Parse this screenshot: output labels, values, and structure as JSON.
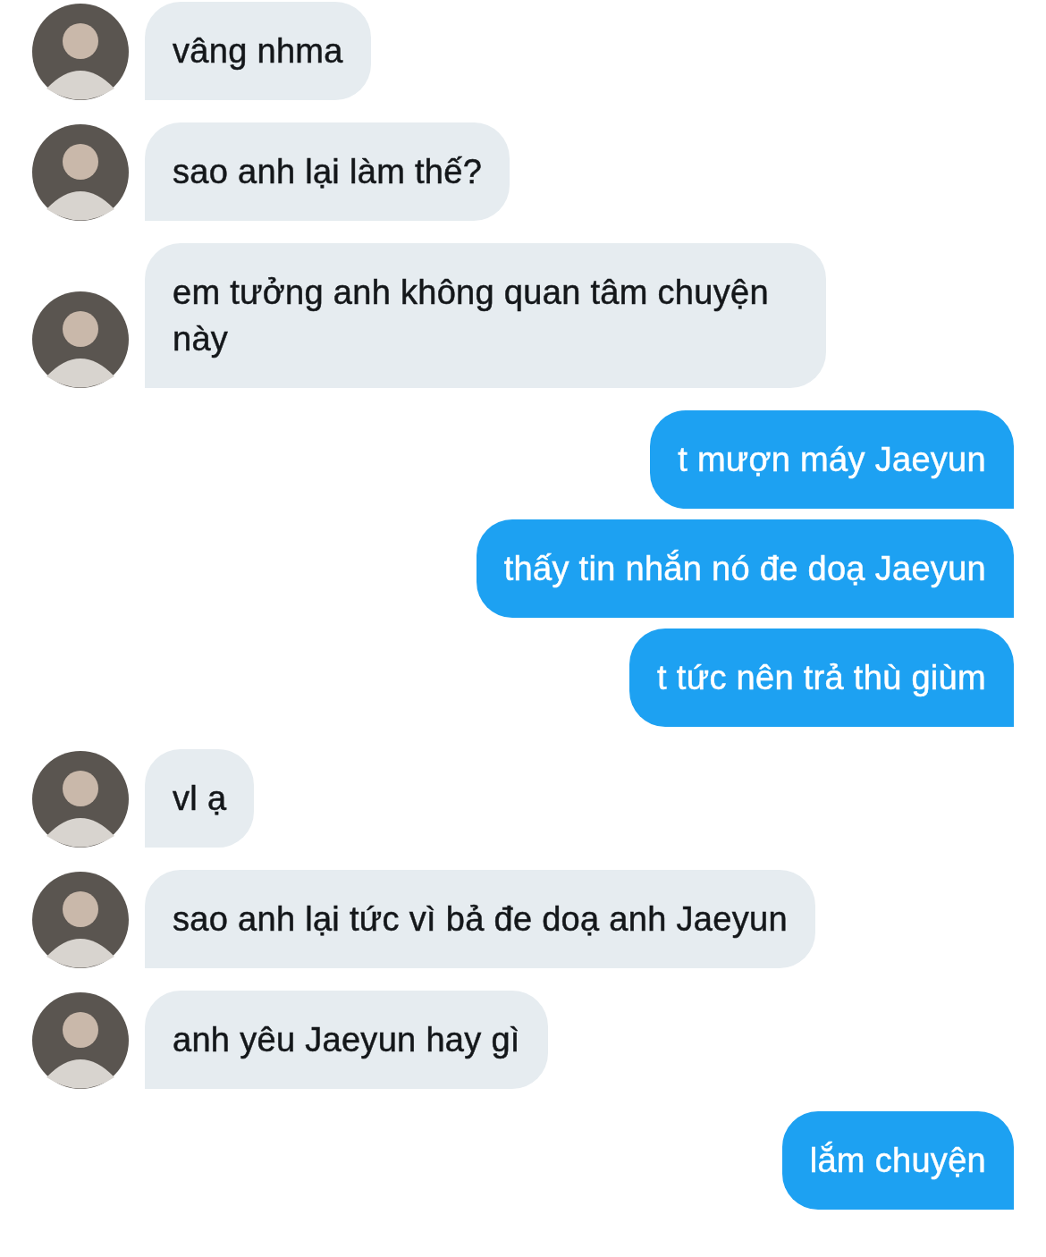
{
  "messages": [
    {
      "kind": "received",
      "text": "vâng nhma"
    },
    {
      "kind": "received",
      "text": "sao anh lại làm thế?"
    },
    {
      "kind": "received",
      "text": "em tưởng anh không quan tâm chuyện này"
    },
    {
      "kind": "sent",
      "text": "t mượn máy Jaeyun"
    },
    {
      "kind": "sent",
      "text": "thấy tin nhắn nó đe doạ Jaeyun"
    },
    {
      "kind": "sent",
      "text": "t tức nên trả thù giùm"
    },
    {
      "kind": "received",
      "text": "vl ạ"
    },
    {
      "kind": "received",
      "text": "sao anh lại tức vì bả đe doạ anh Jaeyun"
    },
    {
      "kind": "received",
      "text": "anh yêu Jaeyun hay gì"
    },
    {
      "kind": "sent",
      "text": "lắm chuyện"
    }
  ]
}
